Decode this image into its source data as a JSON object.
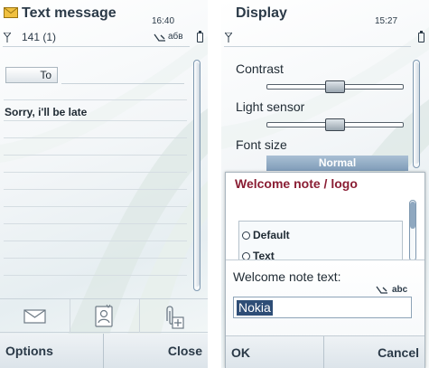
{
  "left_screen": {
    "title": "Text message",
    "clock": "16:40",
    "counter": "141 (1)",
    "to_label": "To",
    "message": "Sorry, i'll be late",
    "toolbar": [
      "envelope-icon",
      "contact-card-icon",
      "paperclip-insert-icon"
    ],
    "softkeys": {
      "left": "Options",
      "right": "Close"
    }
  },
  "right_screen": {
    "title": "Display",
    "clock": "15:27",
    "settings": {
      "contrast": {
        "label": "Contrast",
        "level": 0.5
      },
      "light_sensor": {
        "label": "Light sensor",
        "level": 0.5
      },
      "font_size": {
        "label": "Font size",
        "value": "Normal"
      }
    },
    "popup": {
      "title": "Welcome note / logo",
      "options": [
        "Default",
        "Text"
      ],
      "selected": null
    },
    "query": {
      "label": "Welcome note text:",
      "value": "Nokia",
      "softkeys": {
        "left": "OK",
        "right": "Cancel"
      }
    }
  },
  "status": {
    "input_mode_left": "абв",
    "input_mode_query": "abc"
  },
  "colors": {
    "accent": "#2e4d76",
    "popup_title": "#8a1e34",
    "text": "#2b3a48"
  }
}
